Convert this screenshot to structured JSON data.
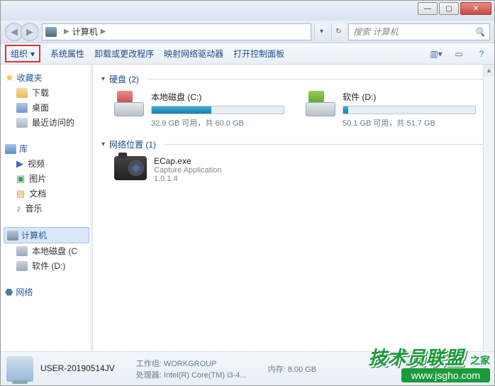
{
  "window": {
    "minimize": "—",
    "maximize": "▢",
    "close": "✕"
  },
  "nav": {
    "back": "◀",
    "forward": "▶",
    "location_label": "计算机",
    "chevron": "▶",
    "refresh": "↻",
    "dropdown": "▾"
  },
  "search": {
    "placeholder": "搜索 计算机",
    "icon": "🔍"
  },
  "toolbar": {
    "organize": "组织",
    "organize_arrow": "▾",
    "sys_props": "系统属性",
    "uninstall": "卸载或更改程序",
    "map_drive": "映射网络驱动器",
    "ctrl_panel": "打开控制面板",
    "view_icon": "▥",
    "view_arrow": "▾",
    "preview_icon": "▭",
    "help_icon": "?"
  },
  "sidebar": {
    "favorites": {
      "label": "收藏夹",
      "items": [
        {
          "label": "下载",
          "icon": "folder"
        },
        {
          "label": "桌面",
          "icon": "desk"
        },
        {
          "label": "最近访问的",
          "icon": "recent"
        }
      ]
    },
    "libraries": {
      "label": "库",
      "items": [
        {
          "label": "视频"
        },
        {
          "label": "图片"
        },
        {
          "label": "文档"
        },
        {
          "label": "音乐"
        }
      ]
    },
    "computer": {
      "label": "计算机",
      "items": [
        {
          "label": "本地磁盘 (C"
        },
        {
          "label": "软件 (D:)"
        }
      ]
    },
    "network": {
      "label": "网络"
    }
  },
  "content": {
    "groups": [
      {
        "title": "硬盘 (2)",
        "drives": [
          {
            "name": "本地磁盘 (C:)",
            "fill_pct": 45,
            "stat": "32.9 GB 可用，共 60.0 GB"
          },
          {
            "name": "软件 (D:)",
            "fill_pct": 4,
            "stat": "50.1 GB 可用，共 51.7 GB"
          }
        ]
      },
      {
        "title": "网络位置 (1)",
        "items": [
          {
            "name": "ECap.exe",
            "desc": "Capture Application",
            "ver": "1.0.1.4"
          }
        ]
      }
    ]
  },
  "details": {
    "name": "USER-20190514JV",
    "workgroup_label": "工作组:",
    "workgroup": "WORKGROUP",
    "mem_label": "内存:",
    "mem": "8.00 GB",
    "cpu_label": "处理器:",
    "cpu": "Intel(R) Core(TM) i3-4..."
  },
  "watermark": {
    "big": "技术员联盟",
    "url": "www.jsgho.com",
    "tag": "之家"
  }
}
